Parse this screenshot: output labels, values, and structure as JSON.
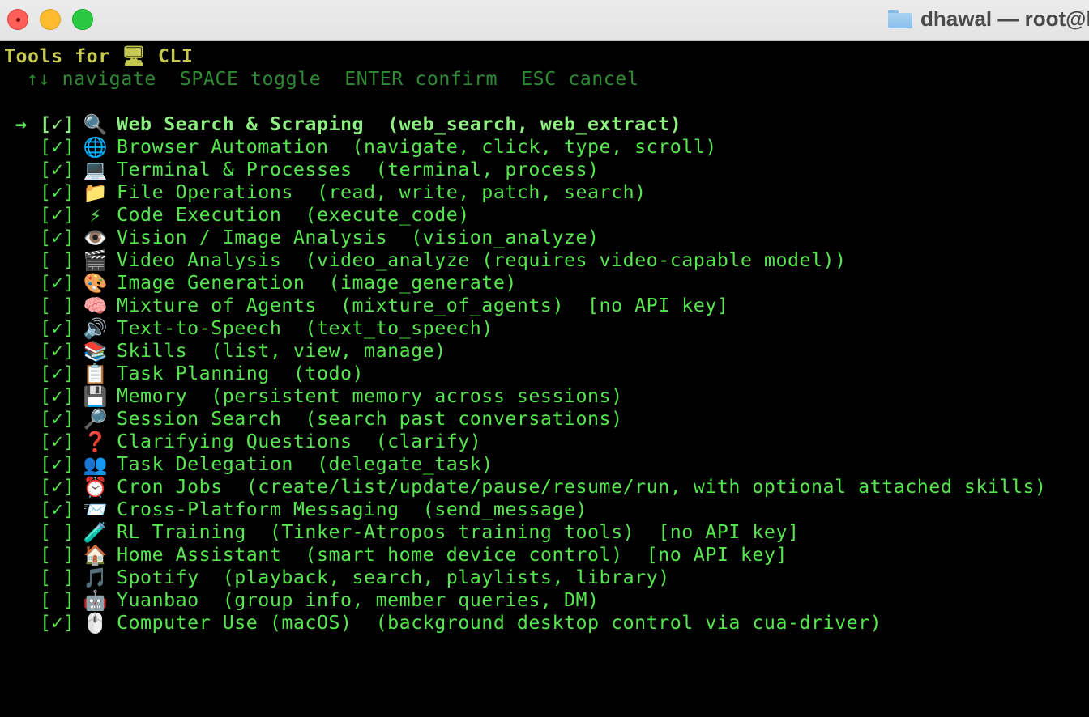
{
  "window": {
    "title": "dhawal — root@l"
  },
  "header": {
    "title": "Tools for 🖥 CLI"
  },
  "hints": {
    "text": "↑↓ navigate  SPACE toggle  ENTER confirm  ESC cancel"
  },
  "cursor": "→",
  "tools": [
    {
      "box": "[✓]",
      "emoji": "🔍",
      "label": "Web Search & Scraping  (web_search, web_extract)",
      "selected": true
    },
    {
      "box": "[✓]",
      "emoji": "🌐",
      "label": "Browser Automation  (navigate, click, type, scroll)"
    },
    {
      "box": "[✓]",
      "emoji": "💻",
      "label": "Terminal & Processes  (terminal, process)"
    },
    {
      "box": "[✓]",
      "emoji": "📁",
      "label": "File Operations  (read, write, patch, search)"
    },
    {
      "box": "[✓]",
      "emoji": "⚡",
      "label": "Code Execution  (execute_code)"
    },
    {
      "box": "[✓]",
      "emoji": "👁️",
      "label": "Vision / Image Analysis  (vision_analyze)"
    },
    {
      "box": "[ ]",
      "emoji": "🎬",
      "label": "Video Analysis  (video_analyze (requires video-capable model))"
    },
    {
      "box": "[✓]",
      "emoji": "🎨",
      "label": "Image Generation  (image_generate)"
    },
    {
      "box": "[ ]",
      "emoji": "🧠",
      "label": "Mixture of Agents  (mixture_of_agents)  [no API key]"
    },
    {
      "box": "[✓]",
      "emoji": "🔊",
      "label": "Text-to-Speech  (text_to_speech)"
    },
    {
      "box": "[✓]",
      "emoji": "📚",
      "label": "Skills  (list, view, manage)"
    },
    {
      "box": "[✓]",
      "emoji": "📋",
      "label": "Task Planning  (todo)"
    },
    {
      "box": "[✓]",
      "emoji": "💾",
      "label": "Memory  (persistent memory across sessions)"
    },
    {
      "box": "[✓]",
      "emoji": "🔎",
      "label": "Session Search  (search past conversations)"
    },
    {
      "box": "[✓]",
      "emoji": "❓",
      "label": "Clarifying Questions  (clarify)"
    },
    {
      "box": "[✓]",
      "emoji": "👥",
      "label": "Task Delegation  (delegate_task)"
    },
    {
      "box": "[✓]",
      "emoji": "⏰",
      "label": "Cron Jobs  (create/list/update/pause/resume/run, with optional attached skills)"
    },
    {
      "box": "[✓]",
      "emoji": "📨",
      "label": "Cross-Platform Messaging  (send_message)"
    },
    {
      "box": "[ ]",
      "emoji": "🧪",
      "label": "RL Training  (Tinker-Atropos training tools)  [no API key]"
    },
    {
      "box": "[ ]",
      "emoji": "🏠",
      "label": "Home Assistant  (smart home device control)  [no API key]"
    },
    {
      "box": "[ ]",
      "emoji": "🎵",
      "label": "Spotify  (playback, search, playlists, library)"
    },
    {
      "box": "[ ]",
      "emoji": "🤖",
      "label": "Yuanbao  (group info, member queries, DM)"
    },
    {
      "box": "[✓]",
      "emoji": "🖱️",
      "label": "Computer Use (macOS)  (background desktop control via cua-driver)"
    }
  ]
}
